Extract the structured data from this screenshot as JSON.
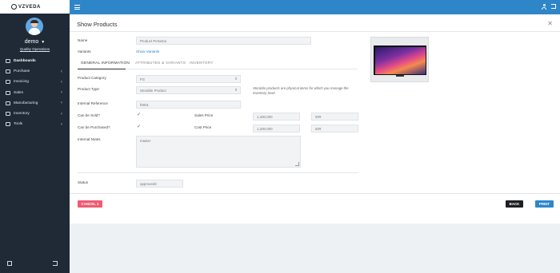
{
  "brand": {
    "name": "VZVEDA"
  },
  "user": {
    "name": "demo",
    "role": "Quality Operations"
  },
  "sidebar": {
    "items": [
      {
        "label": "Dashboards",
        "icon": "home-icon",
        "active": true,
        "has_children": false
      },
      {
        "label": "Purchase",
        "icon": "cart-icon",
        "has_children": true
      },
      {
        "label": "Invoicing",
        "icon": "invoice-icon",
        "has_children": true
      },
      {
        "label": "Sales",
        "icon": "sales-icon",
        "has_children": true
      },
      {
        "label": "Manufacturing",
        "icon": "factory-icon",
        "has_children": true
      },
      {
        "label": "Inventory",
        "icon": "box-icon",
        "has_children": true
      },
      {
        "label": "Tools",
        "icon": "tools-icon",
        "has_children": true
      }
    ],
    "footer_icons": [
      "home-icon",
      "logout-icon"
    ]
  },
  "topbar": {
    "icons": [
      "hamburger-icon",
      "user-icon",
      "logout-icon"
    ]
  },
  "page": {
    "title": "Show Products"
  },
  "form": {
    "name_label": "Name",
    "name_value": "Product Pertama",
    "variants_label": "Variants",
    "variants_link": "Show Variants",
    "tabs": [
      "GENERAL INFORMATION",
      "ATTRIBUTES & VARIANTS",
      "INVENTORY"
    ],
    "active_tab": "GENERAL INFORMATION",
    "category_label": "Product Category",
    "category_value": "FG",
    "type_label": "Product Type",
    "type_value": "Storable Product",
    "type_hint": "Storable products are physical items for which you manage the inventory level.",
    "ref_label": "Internal Reference",
    "ref_value": "f0001",
    "sold_label": "Can be Sold?",
    "sold_checked": true,
    "sales_price_label": "Sales Price",
    "sales_price_value": "1,400,000",
    "sales_currency": "IDR",
    "purchased_label": "Can be Purchased?",
    "purchased_checked": true,
    "cost_price_label": "Cost Price",
    "cost_price_value": "1,200,000",
    "cost_currency": "IDR",
    "notes_label": "Internal Notes",
    "notes_value": "master",
    "status_label": "Status",
    "status_value": "approved3"
  },
  "buttons": {
    "cancel": "CANCEL 1",
    "back": "BACK",
    "print": "PRINT"
  },
  "colors": {
    "topbar": "#2e86c9",
    "sidebar": "#1f2a36",
    "cancel": "#ef5b72",
    "back": "#1d1f22",
    "print": "#2e86c9"
  }
}
